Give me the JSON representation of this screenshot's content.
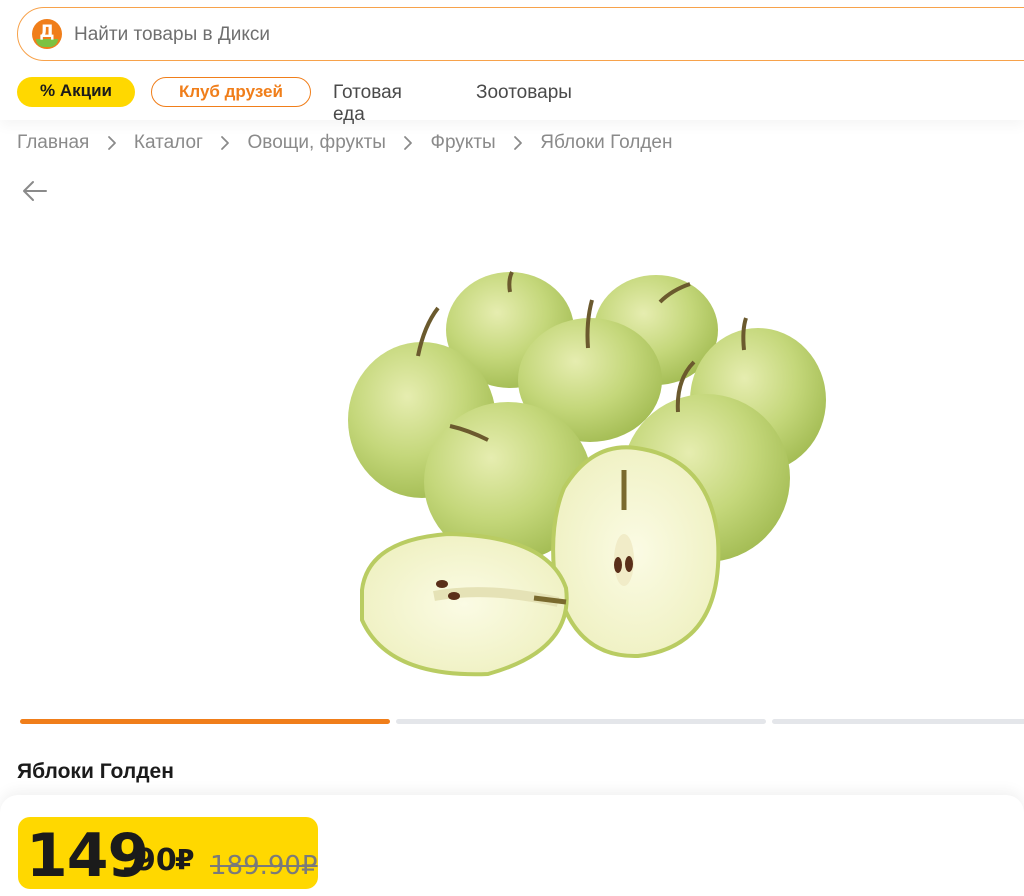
{
  "header": {
    "logo_letter": "Д",
    "search_placeholder": "Найти товары в Дикси"
  },
  "nav": {
    "sale": "% Акции",
    "club": "Клуб друзей",
    "ready_food": "Готовая еда",
    "pet_goods": "Зоотовары"
  },
  "breadcrumb": [
    "Главная",
    "Каталог",
    "Овощи, фрукты",
    "Фрукты",
    "Яблоки Голден"
  ],
  "gallery": {
    "image_icon": "golden-apples-photo",
    "slides": 3,
    "active_slide": 1
  },
  "product": {
    "title": "Яблоки Голден",
    "price_int": "149",
    "price_dot": ".",
    "price_frac": "90",
    "currency": "₽",
    "old_price": "189.90₽"
  },
  "colors": {
    "accent_orange": "#f07e1a",
    "brand_yellow": "#ffd800",
    "logo_green": "#7cc242"
  }
}
